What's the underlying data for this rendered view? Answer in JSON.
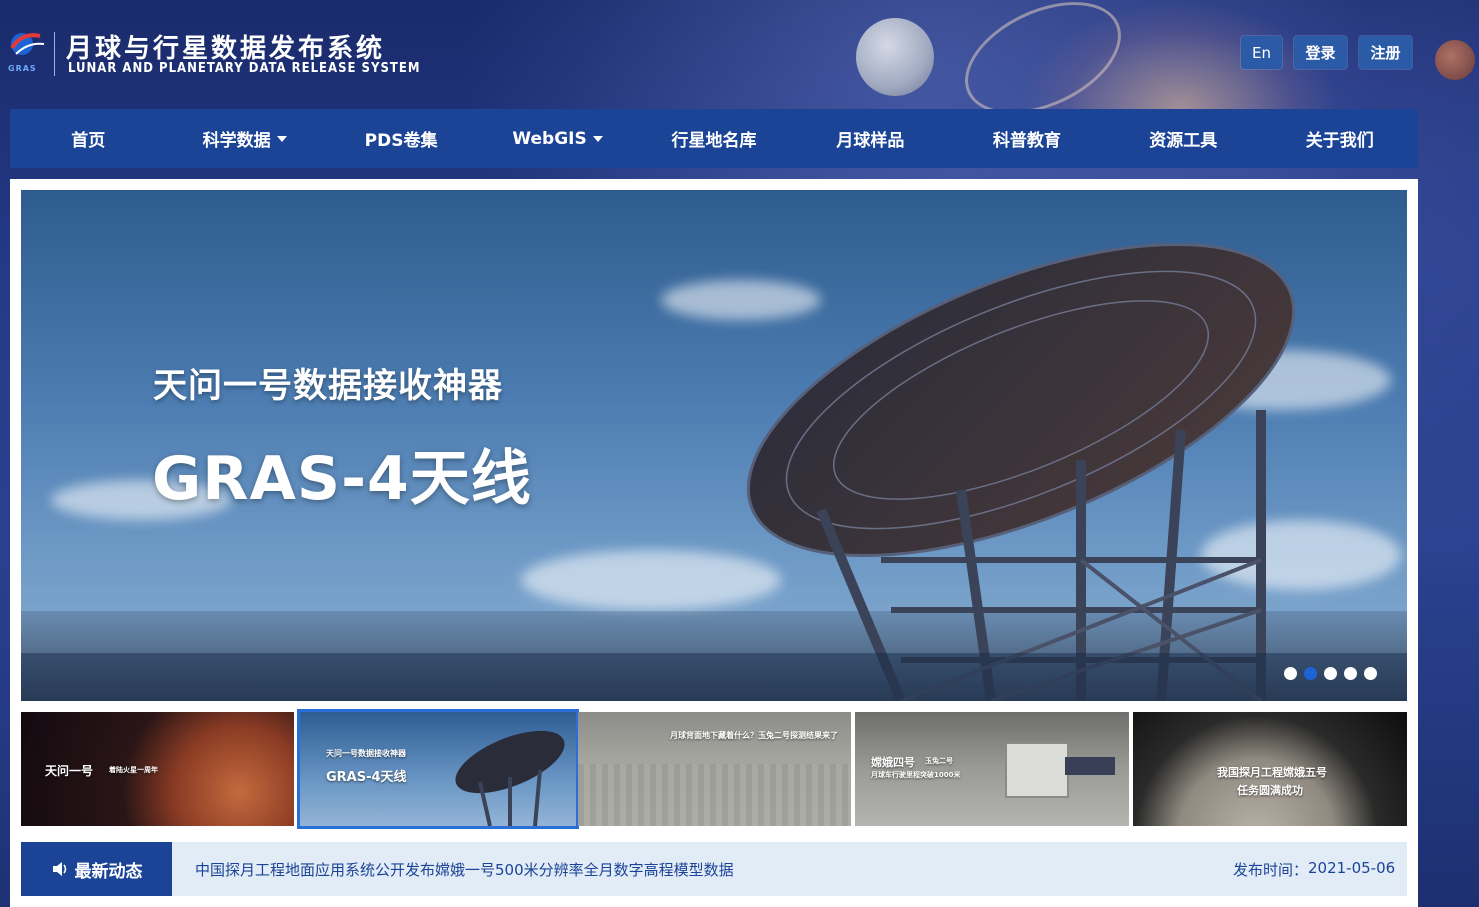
{
  "header": {
    "logo_text": "GRAS",
    "title": "月球与行星数据发布系统",
    "subtitle": "LUNAR AND PLANETARY DATA RELEASE SYSTEM",
    "lang_button": "En",
    "login_button": "登录",
    "register_button": "注册"
  },
  "nav": {
    "items": [
      {
        "label": "首页"
      },
      {
        "label": "科学数据"
      },
      {
        "label": "PDS卷集"
      },
      {
        "label": "WebGIS"
      },
      {
        "label": "行星地名库"
      },
      {
        "label": "月球样品"
      },
      {
        "label": "科普教育"
      },
      {
        "label": "资源工具"
      },
      {
        "label": "关于我们"
      }
    ]
  },
  "banner": {
    "subtitle": "天问一号数据接收神器",
    "title": "GRAS-4天线",
    "active_slide": 2,
    "slide_count": 5
  },
  "thumbnails": [
    {
      "label": "天问一号",
      "small": "着陆火星一周年"
    },
    {
      "label": "天问一号数据接收神器",
      "title": "GRAS-4天线"
    },
    {
      "label": "月球背面地下藏着什么？玉兔二号探测结果来了"
    },
    {
      "label": "嫦娥四号",
      "small": "玉兔二号",
      "caption": "月球车行驶里程突破1000米"
    },
    {
      "label": "我国探月工程嫦娥五号",
      "caption": "任务圆满成功"
    }
  ],
  "news": {
    "tag": "最新动态",
    "text": "中国探月工程地面应用系统公开发布嫦娥一号500米分辨率全月数字高程模型数据",
    "date_label": "发布时间：",
    "date": "2021-05-06"
  },
  "colors": {
    "nav_bg": "#1b4396",
    "button_bg": "#2b5aa6",
    "news_bg": "#e2ecf7",
    "active_dot": "#1e63d6"
  }
}
